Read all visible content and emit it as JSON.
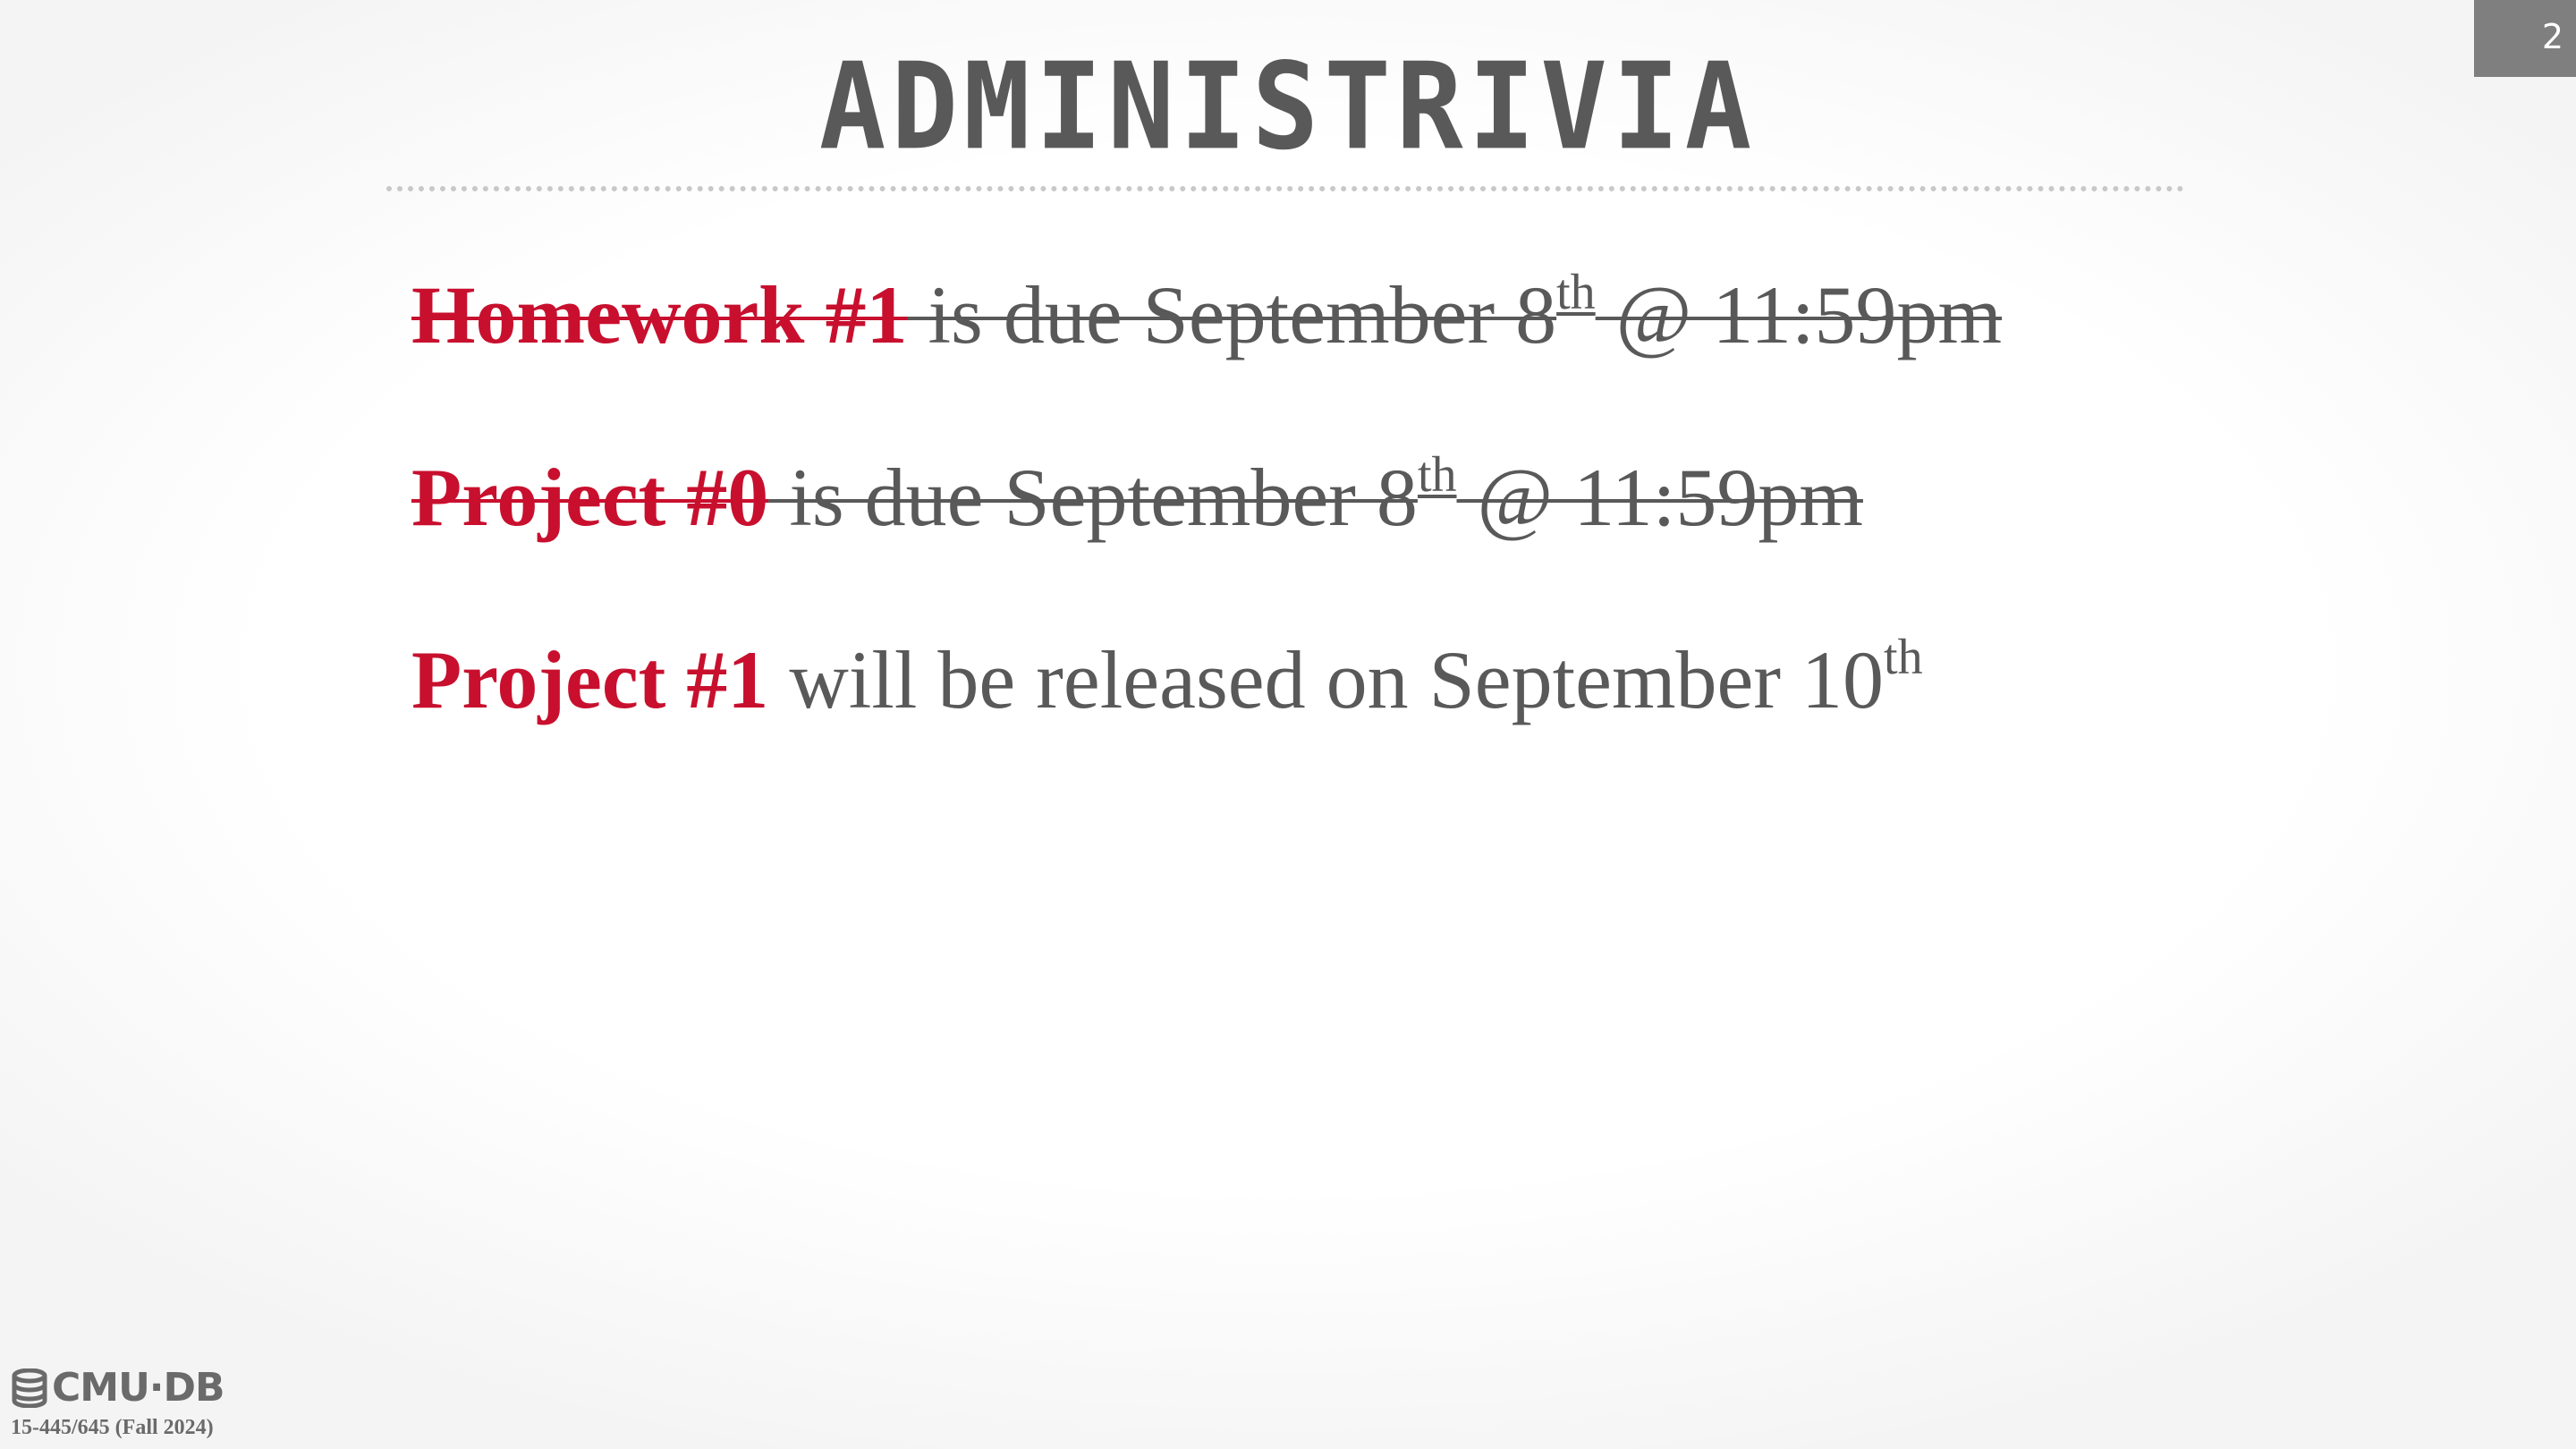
{
  "slide": {
    "page_number": "2",
    "title": "ADMINISTRIVIA"
  },
  "colors": {
    "accent": "#c8102e",
    "body_text": "#595959",
    "page_badge": "#7f7f7f"
  },
  "bullets": [
    {
      "keyword": "Homework #1",
      "text_before_sup": " is due September 8",
      "sup": "th",
      "text_after_sup": " @ 11:59pm",
      "struck_through": true
    },
    {
      "keyword": "Project #0",
      "text_before_sup": " is due September 8",
      "sup": "th",
      "text_after_sup": " @ 11:59pm",
      "struck_through": true
    },
    {
      "keyword": "Project #1",
      "text_before_sup": " will be released on September 10",
      "sup": "th",
      "text_after_sup": "",
      "struck_through": false
    }
  ],
  "footer": {
    "logo_icon": "database-icon",
    "logo_text": "CMU·DB",
    "course": "15-445/645 (Fall 2024)"
  }
}
